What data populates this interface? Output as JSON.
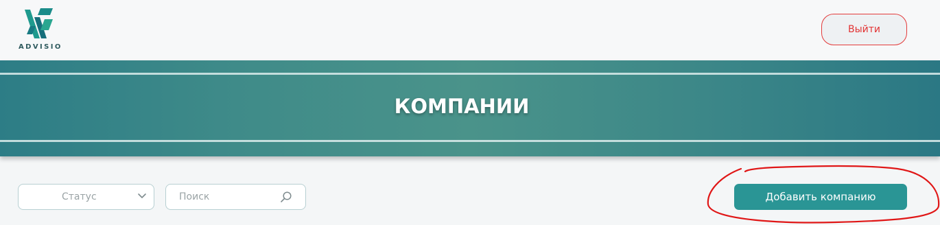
{
  "header": {
    "logo_text": "ADVISIO",
    "logo_icon": "advisio-logo-icon",
    "logout_label": "Выйти",
    "logout_color": "#e23333"
  },
  "banner": {
    "title": "КОМПАНИИ",
    "accent": "#2d7d86"
  },
  "filters": {
    "status_selected": "Статус",
    "status_icon": "chevron-down-icon",
    "search_placeholder": "Поиск",
    "search_value": "",
    "search_icon": "search-icon"
  },
  "actions": {
    "add_company_label": "Добавить компанию",
    "add_company_color": "#2a9595"
  },
  "annotation": {
    "type": "red-freehand-circle",
    "color": "#e01616"
  }
}
